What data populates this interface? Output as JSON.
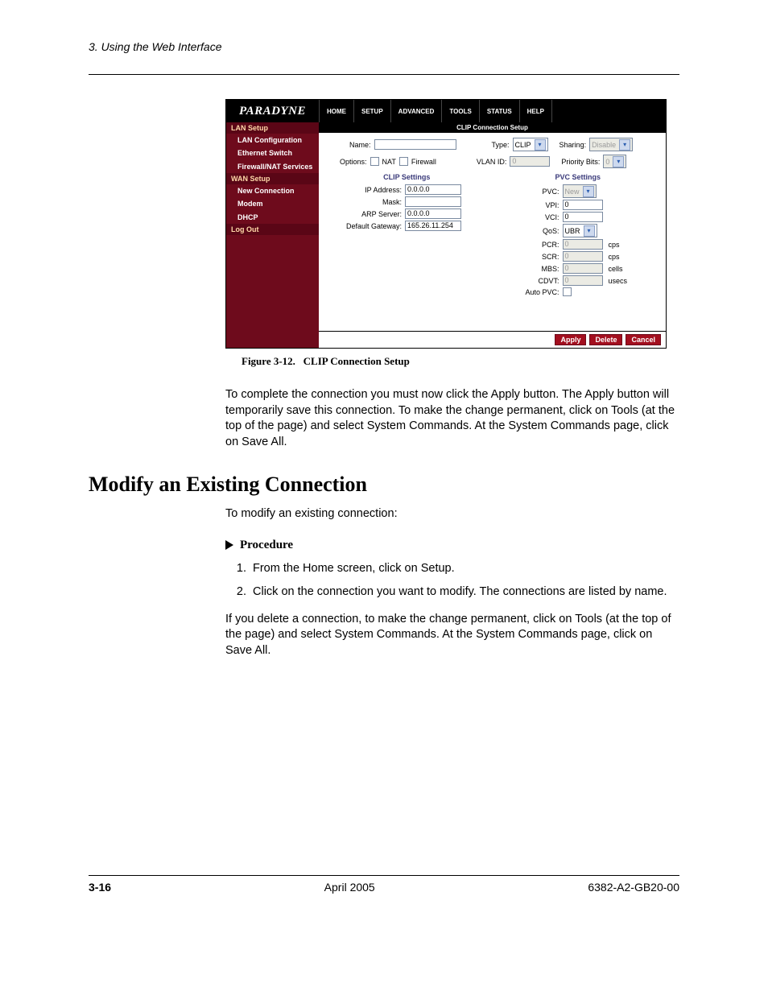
{
  "doc": {
    "running_head": "3. Using the Web Interface",
    "caption_label": "Figure 3-12.",
    "caption_text": "CLIP Connection Setup",
    "para1": "To complete the connection you must now click the Apply button. The Apply button will temporarily save this connection. To make the change permanent, click on Tools (at the top of the page) and select System Commands. At the System Commands page, click on Save All.",
    "section_heading": "Modify an Existing Connection",
    "para2": "To modify an existing connection:",
    "procedure_label": "Procedure",
    "step1": "From the Home screen, click on Setup.",
    "step2": "Click on the connection you want to modify. The connections are listed by name.",
    "para3": "If you delete a connection, to make the change permanent, click on Tools (at the top of the page) and select System Commands. At the System Commands page, click on Save All.",
    "page_num": "3-16",
    "footer_date": "April 2005",
    "footer_doc": "6382-A2-GB20-00"
  },
  "app": {
    "brand": "PARADYNE",
    "tabs": [
      "HOME",
      "SETUP",
      "ADVANCED",
      "TOOLS",
      "STATUS",
      "HELP"
    ],
    "sidebar": {
      "lan_head": "LAN Setup",
      "lan_items": [
        "LAN Configuration",
        "Ethernet Switch",
        "Firewall/NAT Services"
      ],
      "wan_head": "WAN Setup",
      "wan_items": [
        "New Connection",
        "Modem",
        "DHCP"
      ],
      "logout": "Log Out"
    },
    "title": "CLIP Connection Setup",
    "top": {
      "name_label": "Name:",
      "name_value": "",
      "type_label": "Type:",
      "type_value": "CLIP",
      "sharing_label": "Sharing:",
      "sharing_value": "Disable",
      "options_label": "Options:",
      "opt_nat": "NAT",
      "opt_firewall": "Firewall",
      "vlan_label": "VLAN ID:",
      "vlan_value": "0",
      "priority_label": "Priority Bits:",
      "priority_value": "0"
    },
    "clip": {
      "head": "CLIP Settings",
      "ip_label": "IP Address:",
      "ip_value": "0.0.0.0",
      "mask_label": "Mask:",
      "mask_value": "",
      "arp_label": "ARP Server:",
      "arp_value": "0.0.0.0",
      "gw_label": "Default Gateway:",
      "gw_value": "165.26.11.254"
    },
    "pvc": {
      "head": "PVC Settings",
      "pvc_label": "PVC:",
      "pvc_value": "New",
      "vpi_label": "VPI:",
      "vpi_value": "0",
      "vci_label": "VCI:",
      "vci_value": "0",
      "qos_label": "QoS:",
      "qos_value": "UBR",
      "pcr_label": "PCR:",
      "pcr_value": "0",
      "pcr_unit": "cps",
      "scr_label": "SCR:",
      "scr_value": "0",
      "scr_unit": "cps",
      "mbs_label": "MBS:",
      "mbs_value": "0",
      "mbs_unit": "cells",
      "cdvt_label": "CDVT:",
      "cdvt_value": "0",
      "cdvt_unit": "usecs",
      "auto_label": "Auto PVC:"
    },
    "buttons": {
      "apply": "Apply",
      "delete": "Delete",
      "cancel": "Cancel"
    }
  }
}
